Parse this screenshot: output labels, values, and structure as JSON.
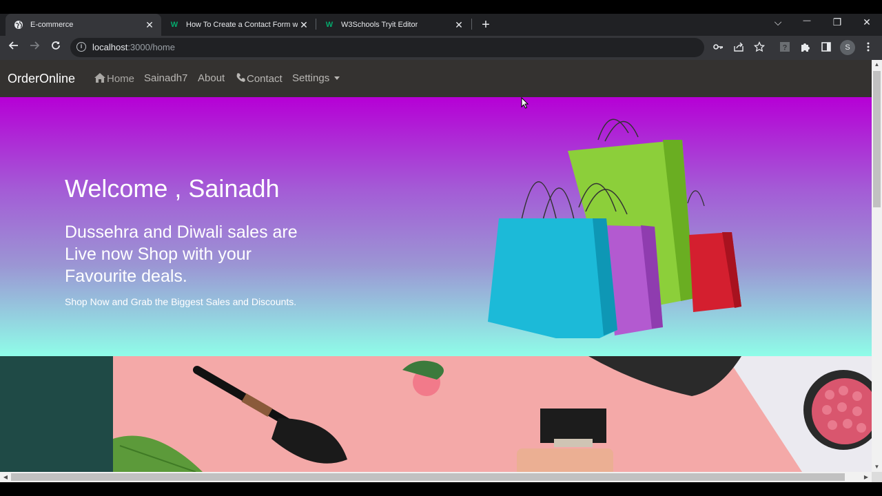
{
  "browser": {
    "tabs": [
      {
        "title": "E-commerce",
        "icon": "globe-icon",
        "active": true
      },
      {
        "title": "How To Create a Contact Form with",
        "icon": "w3schools-icon",
        "active": false
      },
      {
        "title": "W3Schools Tryit Editor",
        "icon": "w3schools-icon",
        "active": false
      }
    ],
    "close_glyph": "✕",
    "new_tab_glyph": "+",
    "url_host": "localhost",
    "url_path": ":3000/home",
    "profile_initial": "S",
    "window_controls": {
      "list": "⌵",
      "minimize": "—",
      "restore": "❐",
      "close": "✕"
    },
    "toolbar_icons": [
      "key-icon",
      "share-icon",
      "star-icon",
      "extension-question-icon",
      "puzzle-icon",
      "side-panel-icon",
      "profile-icon",
      "more-menu-icon"
    ]
  },
  "site": {
    "brand": "OrderOnline",
    "nav": {
      "home": "Home",
      "user": "Sainadh7",
      "about": "About",
      "contact": "Contact",
      "settings": "Settings"
    },
    "hero": {
      "title": "Welcome , Sainadh",
      "subtitle": "Dussehra and Diwali sales are Live now Shop with your Favourite deals.",
      "tagline": "Shop Now and Grab the Biggest Sales and Discounts."
    },
    "colors": {
      "navbar": "#343230",
      "hero_top": "#b600d6",
      "hero_bottom": "#8ffde8",
      "banner_left": "#1f4a46",
      "banner_pink": "#f4a9a8"
    }
  }
}
